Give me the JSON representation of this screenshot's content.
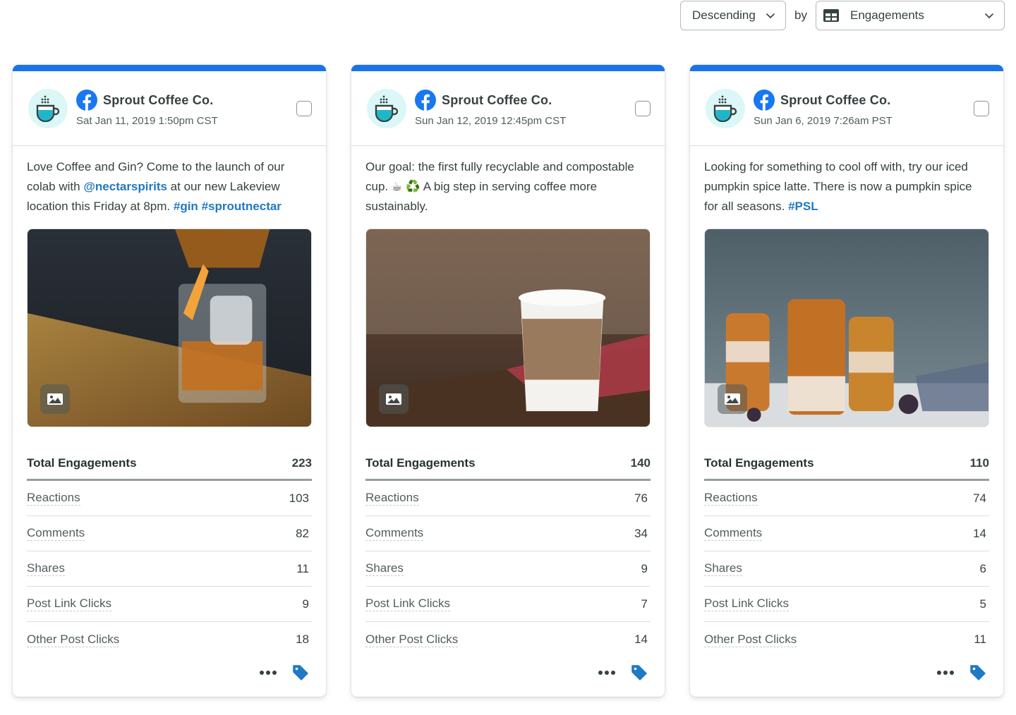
{
  "sort": {
    "order_label": "Descending",
    "by_label": "by",
    "metric_label": "Engagements",
    "metric_icon": "table-grid-icon"
  },
  "colors": {
    "accent_bar": "#1a73e8",
    "facebook": "#1877f2",
    "link": "#2079c3",
    "tag": "#2079c3",
    "avatar_bg": "#dbf7f8",
    "cup_fill": "#1fb6c9"
  },
  "cards": [
    {
      "profile_name": "Sprout Coffee Co.",
      "network_icon": "facebook-icon",
      "date": "Sat Jan 11, 2019 1:50pm CST",
      "text_parts": [
        {
          "text": "Love Coffee and Gin? Come to the launch of our colab with ",
          "link": false
        },
        {
          "text": "@nectarspirits",
          "link": true
        },
        {
          "text": " at our new Lakeview location this Friday at 8pm. ",
          "link": false
        },
        {
          "text": "#gin",
          "link": true
        },
        {
          "text": " ",
          "link": false
        },
        {
          "text": "#sproutnectar",
          "link": true
        }
      ],
      "media_alt": "Cocktail being poured over ice with orange peel",
      "media_type_icon": "image-icon",
      "metrics": [
        {
          "name": "Total Engagements",
          "value": "223"
        },
        {
          "name": "Reactions",
          "value": "103"
        },
        {
          "name": "Comments",
          "value": "82"
        },
        {
          "name": "Shares",
          "value": "11"
        },
        {
          "name": "Post Link Clicks",
          "value": "9"
        },
        {
          "name": "Other Post Clicks",
          "value": "18"
        }
      ]
    },
    {
      "profile_name": "Sprout Coffee Co.",
      "network_icon": "facebook-icon",
      "date": "Sun Jan 12, 2019 12:45pm CST",
      "text_parts": [
        {
          "text": "Our goal: the first fully recyclable and compostable cup. ☕ ♻️  A big step in serving coffee more sustainably.",
          "link": false
        }
      ],
      "media_alt": "Paper coffee cup with sleeve on wooden table",
      "media_type_icon": "image-icon",
      "metrics": [
        {
          "name": "Total Engagements",
          "value": "140"
        },
        {
          "name": "Reactions",
          "value": "76"
        },
        {
          "name": "Comments",
          "value": "34"
        },
        {
          "name": "Shares",
          "value": "9"
        },
        {
          "name": "Post Link Clicks",
          "value": "7"
        },
        {
          "name": "Other Post Clicks",
          "value": "14"
        }
      ]
    },
    {
      "profile_name": "Sprout Coffee Co.",
      "network_icon": "facebook-icon",
      "date": "Sun Jan 6, 2019 7:26am PST",
      "text_parts": [
        {
          "text": "Looking for something to cool off with, try our iced pumpkin spice latte. There is now a pumpkin spice for all seasons. ",
          "link": false
        },
        {
          "text": "#PSL",
          "link": true
        }
      ],
      "media_alt": "Iced pumpkin spice lattes in jars with figs",
      "media_type_icon": "image-icon",
      "metrics": [
        {
          "name": "Total Engagements",
          "value": "110"
        },
        {
          "name": "Reactions",
          "value": "74"
        },
        {
          "name": "Comments",
          "value": "14"
        },
        {
          "name": "Shares",
          "value": "6"
        },
        {
          "name": "Post Link Clicks",
          "value": "5"
        },
        {
          "name": "Other Post Clicks",
          "value": "11"
        }
      ]
    }
  ]
}
